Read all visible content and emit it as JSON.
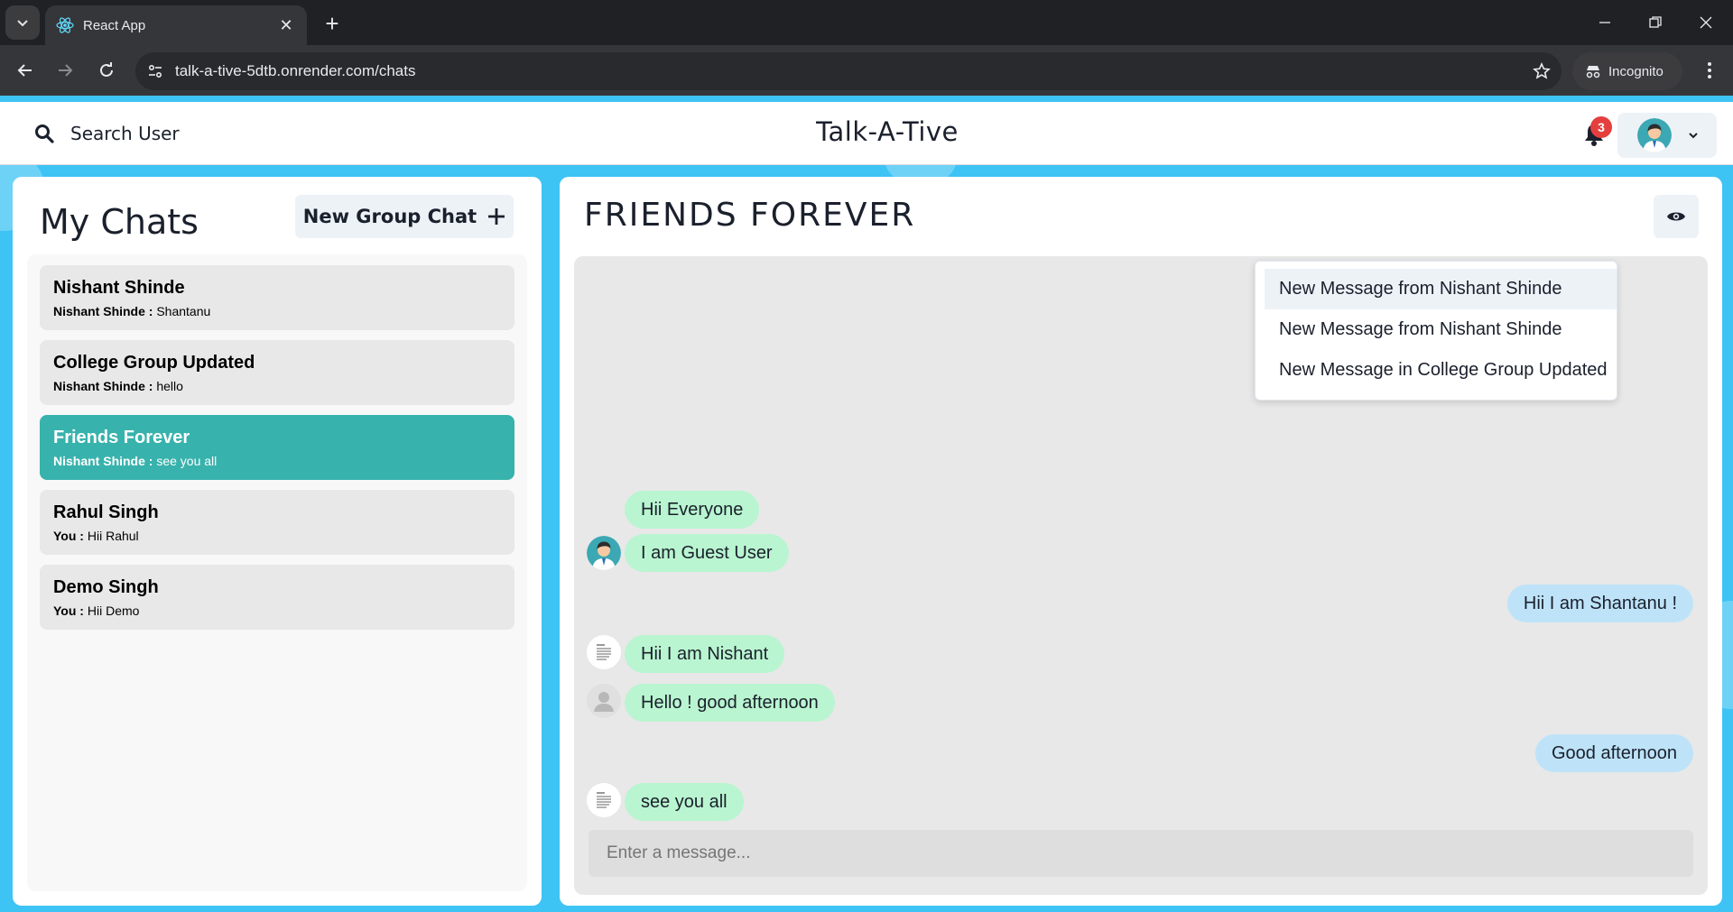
{
  "browser": {
    "tab_title": "React App",
    "url": "talk-a-tive-5dtb.onrender.com/chats",
    "incognito_label": "Incognito"
  },
  "header": {
    "search_label": "Search User",
    "app_title": "Talk-A-Tive",
    "notification_count": "3"
  },
  "notifications": [
    "New Message from Nishant Shinde",
    "New Message from Nishant Shinde",
    "New Message in College Group Updated"
  ],
  "sidebar": {
    "title": "My Chats",
    "new_group_label": "New Group Chat",
    "chats": [
      {
        "name": "Nishant Shinde",
        "sender": "Nishant Shinde :",
        "last": "Shantanu",
        "active": false
      },
      {
        "name": "College Group Updated",
        "sender": "Nishant Shinde :",
        "last": "hello",
        "active": false
      },
      {
        "name": "Friends Forever",
        "sender": "Nishant Shinde :",
        "last": "see you all",
        "active": true
      },
      {
        "name": "Rahul Singh",
        "sender": "You :",
        "last": "Hii Rahul",
        "active": false
      },
      {
        "name": "Demo Singh",
        "sender": "You :",
        "last": "Hii Demo",
        "active": false
      }
    ]
  },
  "chat": {
    "title": "FRIENDS FOREVER",
    "messages": [
      {
        "text": "Hii Everyone",
        "from": "other"
      },
      {
        "text": "I am Guest User",
        "from": "other"
      },
      {
        "text": "Hii I am Shantanu !",
        "from": "me"
      },
      {
        "text": "Hii I am Nishant",
        "from": "other"
      },
      {
        "text": "Hello ! good afternoon",
        "from": "other"
      },
      {
        "text": "Good afternoon",
        "from": "me"
      },
      {
        "text": "see you all",
        "from": "other"
      }
    ],
    "input_placeholder": "Enter a message..."
  },
  "colors": {
    "background": "#3ec3f5",
    "active_chat": "#38b2ac",
    "other_bubble": "#b9f5d0",
    "my_bubble": "#bee3f8",
    "badge": "#e53e3e"
  }
}
